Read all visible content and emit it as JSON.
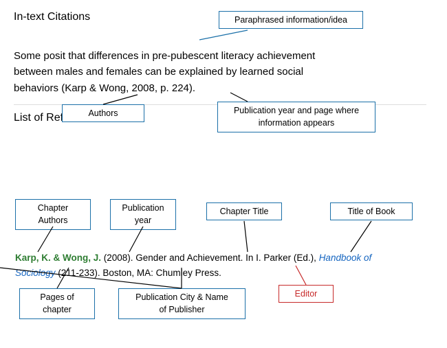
{
  "sections": {
    "intext_title": "In-text Citations",
    "list_title": "List of References"
  },
  "citation": {
    "text_part1": "Some posit that differences  in pre-pubescent  literacy  achievement",
    "text_part2": "between males and females  can be explained  by learned  social",
    "text_part3": "behaviors (Karp & Wong, 2008, p. 224)."
  },
  "labels": {
    "paraphrased": "Paraphrased information/idea",
    "authors": "Authors",
    "pub_year_page": "Publication year and page where\ninformation appears",
    "chapter_authors": "Chapter\nAuthors",
    "publication_year": "Publication\nyear",
    "chapter_title": "Chapter Title",
    "title_of_book": "Title of Book",
    "pages_chapter": "Pages of\nchapter",
    "pub_city_publisher": "Publication City & Name\nof Publisher",
    "editor": "Editor"
  },
  "reference": {
    "authors_green": "Karp, K. & Wong, J.",
    "middle": "  (2008).  Gender and Achievement. In I. Parker (Ed.), ",
    "italic_blue": "Handbook of Sociology",
    "end": " (211-233). Boston, MA: Chumley Press."
  }
}
